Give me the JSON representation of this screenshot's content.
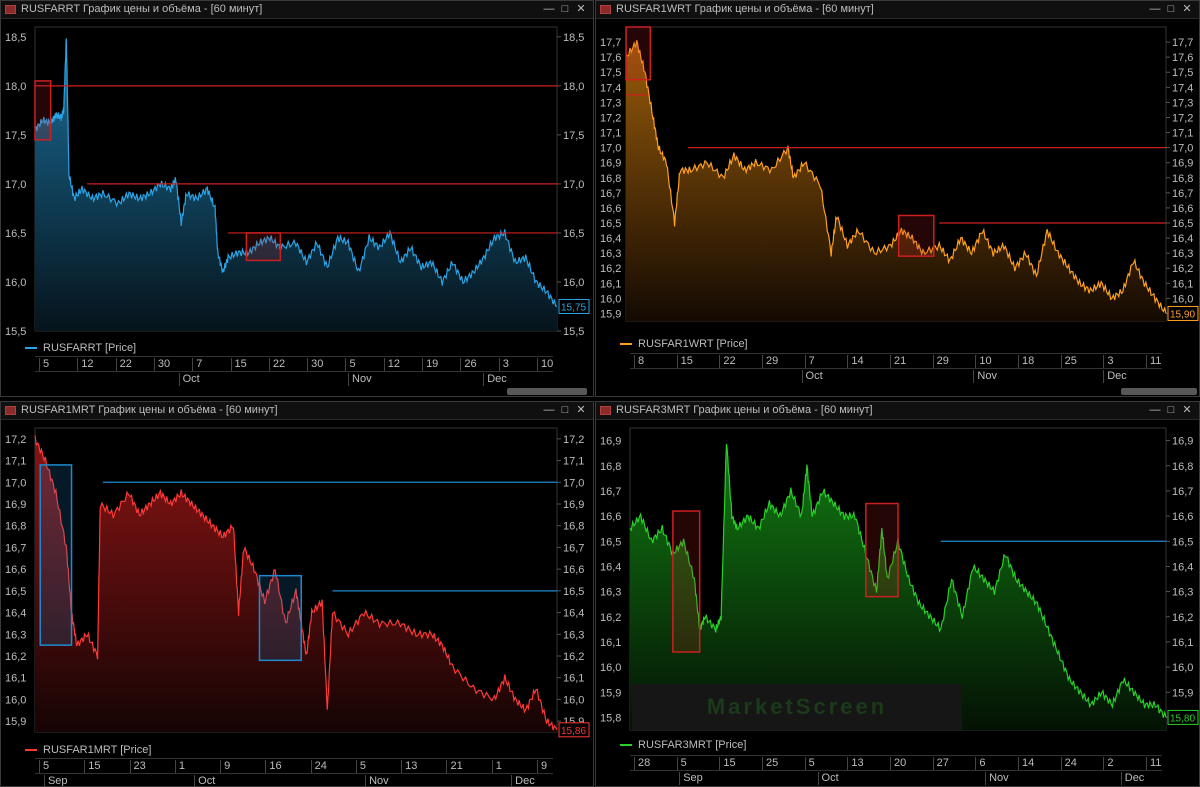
{
  "panels": [
    {
      "id": "p1",
      "title": "RUSFARRT График цены и объёма - [60 минут]",
      "legend": "RUSFARRT [Price]",
      "color": "#2aa4e6",
      "fill_top": "#1a6e9a",
      "fill_bot": "#06141c",
      "ylim": [
        15.5,
        18.6
      ],
      "ticks": [
        "15,5",
        "16,0",
        "16,5",
        "17,0",
        "17,5",
        "18,0",
        "18,5"
      ],
      "last": "15,75",
      "last_color": "#2aa4e6",
      "hlines": [
        {
          "y": 18.0,
          "color": "#cc2020",
          "from": 0.0
        },
        {
          "y": 17.0,
          "color": "#cc2020",
          "from": 0.1
        },
        {
          "y": 16.5,
          "color": "#cc2020",
          "from": 0.37
        }
      ],
      "boxes": [
        {
          "x0": 0.0,
          "x1": 0.03,
          "y0": 17.45,
          "y1": 18.05,
          "color": "#cc2020"
        },
        {
          "x0": 0.405,
          "x1": 0.47,
          "y0": 16.22,
          "y1": 16.5,
          "color": "#cc2020"
        }
      ],
      "xticks": [
        "5",
        "12",
        "22",
        "30",
        "7",
        "15",
        "22",
        "30",
        "5",
        "12",
        "19",
        "26",
        "3",
        "10"
      ],
      "months": [
        {
          "label": "Oct",
          "pos": 0.285
        },
        {
          "label": "Nov",
          "pos": 0.612
        },
        {
          "label": "Dec",
          "pos": 0.873
        }
      ],
      "series": [
        [
          0,
          17.55
        ],
        [
          0.015,
          17.65
        ],
        [
          0.03,
          17.62
        ],
        [
          0.04,
          17.7
        ],
        [
          0.05,
          17.68
        ],
        [
          0.055,
          17.75
        ],
        [
          0.06,
          18.5
        ],
        [
          0.065,
          17.1
        ],
        [
          0.075,
          16.85
        ],
        [
          0.09,
          16.95
        ],
        [
          0.11,
          16.85
        ],
        [
          0.13,
          16.9
        ],
        [
          0.16,
          16.8
        ],
        [
          0.18,
          16.9
        ],
        [
          0.2,
          16.85
        ],
        [
          0.22,
          16.9
        ],
        [
          0.24,
          17.0
        ],
        [
          0.26,
          16.95
        ],
        [
          0.27,
          17.05
        ],
        [
          0.28,
          16.6
        ],
        [
          0.29,
          16.9
        ],
        [
          0.31,
          16.85
        ],
        [
          0.33,
          16.95
        ],
        [
          0.345,
          16.75
        ],
        [
          0.35,
          16.3
        ],
        [
          0.36,
          16.1
        ],
        [
          0.37,
          16.25
        ],
        [
          0.39,
          16.3
        ],
        [
          0.41,
          16.3
        ],
        [
          0.43,
          16.4
        ],
        [
          0.45,
          16.45
        ],
        [
          0.47,
          16.35
        ],
        [
          0.5,
          16.4
        ],
        [
          0.52,
          16.2
        ],
        [
          0.54,
          16.4
        ],
        [
          0.56,
          16.15
        ],
        [
          0.58,
          16.45
        ],
        [
          0.6,
          16.4
        ],
        [
          0.62,
          16.1
        ],
        [
          0.64,
          16.45
        ],
        [
          0.66,
          16.35
        ],
        [
          0.68,
          16.5
        ],
        [
          0.7,
          16.2
        ],
        [
          0.72,
          16.35
        ],
        [
          0.74,
          16.15
        ],
        [
          0.76,
          16.2
        ],
        [
          0.78,
          16.0
        ],
        [
          0.8,
          16.2
        ],
        [
          0.82,
          16.0
        ],
        [
          0.84,
          16.1
        ],
        [
          0.86,
          16.25
        ],
        [
          0.88,
          16.45
        ],
        [
          0.9,
          16.5
        ],
        [
          0.92,
          16.2
        ],
        [
          0.94,
          16.25
        ],
        [
          0.96,
          16.0
        ],
        [
          0.98,
          15.9
        ],
        [
          1.0,
          15.75
        ]
      ]
    },
    {
      "id": "p2",
      "title": "RUSFAR1WRT График цены и объёма - [60 минут]",
      "legend": "RUSFAR1WRT [Price]",
      "color": "#ffa020",
      "fill_top": "#9a5c0a",
      "fill_bot": "#140a02",
      "ylim": [
        15.85,
        17.8
      ],
      "ticks": [
        "15,9",
        "16,0",
        "16,1",
        "16,2",
        "16,3",
        "16,4",
        "16,5",
        "16,6",
        "16,7",
        "16,8",
        "16,9",
        "17,0",
        "17,1",
        "17,2",
        "17,3",
        "17,4",
        "17,5",
        "17,6",
        "17,7"
      ],
      "last": "15,90",
      "last_color": "#ffa020",
      "hlines": [
        {
          "y": 17.35,
          "color": "#cc2020",
          "from": 0.0,
          "to": 0.04
        },
        {
          "y": 17.0,
          "color": "#cc2020",
          "from": 0.115
        },
        {
          "y": 16.5,
          "color": "#cc2020",
          "from": 0.58
        }
      ],
      "boxes": [
        {
          "x0": 0.0,
          "x1": 0.045,
          "y0": 17.45,
          "y1": 17.8,
          "color": "#cc2020"
        },
        {
          "x0": 0.505,
          "x1": 0.57,
          "y0": 16.28,
          "y1": 16.55,
          "color": "#cc2020"
        }
      ],
      "xticks": [
        "8",
        "15",
        "22",
        "29",
        "7",
        "14",
        "21",
        "29",
        "10",
        "18",
        "25",
        "3",
        "11"
      ],
      "months": [
        {
          "label": "Oct",
          "pos": 0.33
        },
        {
          "label": "Nov",
          "pos": 0.653
        },
        {
          "label": "Dec",
          "pos": 0.897
        }
      ],
      "series": [
        [
          0,
          17.6
        ],
        [
          0.02,
          17.7
        ],
        [
          0.035,
          17.5
        ],
        [
          0.05,
          17.2
        ],
        [
          0.06,
          17.0
        ],
        [
          0.075,
          16.9
        ],
        [
          0.09,
          16.5
        ],
        [
          0.1,
          16.85
        ],
        [
          0.12,
          16.85
        ],
        [
          0.15,
          16.9
        ],
        [
          0.18,
          16.8
        ],
        [
          0.2,
          16.95
        ],
        [
          0.22,
          16.85
        ],
        [
          0.24,
          16.9
        ],
        [
          0.27,
          16.85
        ],
        [
          0.3,
          17.0
        ],
        [
          0.31,
          16.8
        ],
        [
          0.33,
          16.9
        ],
        [
          0.36,
          16.75
        ],
        [
          0.38,
          16.3
        ],
        [
          0.39,
          16.55
        ],
        [
          0.41,
          16.35
        ],
        [
          0.43,
          16.45
        ],
        [
          0.46,
          16.3
        ],
        [
          0.49,
          16.35
        ],
        [
          0.51,
          16.45
        ],
        [
          0.53,
          16.4
        ],
        [
          0.55,
          16.3
        ],
        [
          0.58,
          16.35
        ],
        [
          0.6,
          16.25
        ],
        [
          0.62,
          16.4
        ],
        [
          0.64,
          16.3
        ],
        [
          0.66,
          16.45
        ],
        [
          0.68,
          16.3
        ],
        [
          0.7,
          16.35
        ],
        [
          0.72,
          16.2
        ],
        [
          0.74,
          16.3
        ],
        [
          0.76,
          16.15
        ],
        [
          0.78,
          16.45
        ],
        [
          0.8,
          16.3
        ],
        [
          0.82,
          16.2
        ],
        [
          0.84,
          16.1
        ],
        [
          0.86,
          16.05
        ],
        [
          0.88,
          16.1
        ],
        [
          0.9,
          16.0
        ],
        [
          0.92,
          16.05
        ],
        [
          0.94,
          16.25
        ],
        [
          0.96,
          16.1
        ],
        [
          0.98,
          16.0
        ],
        [
          1.0,
          15.9
        ]
      ]
    },
    {
      "id": "p3",
      "title": "RUSFAR1MRT График цены и объёма - [60 минут]",
      "legend": "RUSFAR1MRT [Price]",
      "color": "#ff3838",
      "fill_top": "#8a1414",
      "fill_bot": "#160404",
      "ylim": [
        15.85,
        17.25
      ],
      "ticks": [
        "15,9",
        "16,0",
        "16,1",
        "16,2",
        "16,3",
        "16,4",
        "16,5",
        "16,6",
        "16,7",
        "16,8",
        "16,9",
        "17,0",
        "17,1",
        "17,2"
      ],
      "last": "15,86",
      "last_color": "#ff3838",
      "hlines": [
        {
          "y": 17.0,
          "color": "#1d8ad0",
          "from": 0.13
        },
        {
          "y": 16.5,
          "color": "#1d8ad0",
          "from": 0.57
        }
      ],
      "boxes": [
        {
          "x0": 0.01,
          "x1": 0.07,
          "y0": 16.25,
          "y1": 17.08,
          "color": "#1d8ad0"
        },
        {
          "x0": 0.43,
          "x1": 0.51,
          "y0": 16.18,
          "y1": 16.57,
          "color": "#1d8ad0"
        }
      ],
      "xticks": [
        "5",
        "15",
        "23",
        "1",
        "9",
        "16",
        "24",
        "5",
        "13",
        "21",
        "1",
        "9"
      ],
      "months": [
        {
          "label": "Sep",
          "pos": 0.025
        },
        {
          "label": "Oct",
          "pos": 0.315
        },
        {
          "label": "Nov",
          "pos": 0.645
        },
        {
          "label": "Dec",
          "pos": 0.927
        }
      ],
      "series": [
        [
          0,
          17.2
        ],
        [
          0.02,
          17.1
        ],
        [
          0.04,
          16.95
        ],
        [
          0.06,
          16.7
        ],
        [
          0.07,
          16.4
        ],
        [
          0.08,
          16.25
        ],
        [
          0.1,
          16.3
        ],
        [
          0.12,
          16.2
        ],
        [
          0.125,
          16.9
        ],
        [
          0.15,
          16.85
        ],
        [
          0.18,
          16.95
        ],
        [
          0.2,
          16.85
        ],
        [
          0.22,
          16.9
        ],
        [
          0.24,
          16.95
        ],
        [
          0.26,
          16.9
        ],
        [
          0.28,
          16.95
        ],
        [
          0.3,
          16.9
        ],
        [
          0.32,
          16.85
        ],
        [
          0.34,
          16.8
        ],
        [
          0.36,
          16.75
        ],
        [
          0.38,
          16.8
        ],
        [
          0.39,
          16.4
        ],
        [
          0.4,
          16.7
        ],
        [
          0.42,
          16.6
        ],
        [
          0.44,
          16.45
        ],
        [
          0.46,
          16.6
        ],
        [
          0.48,
          16.35
        ],
        [
          0.5,
          16.5
        ],
        [
          0.51,
          16.35
        ],
        [
          0.52,
          16.2
        ],
        [
          0.53,
          16.4
        ],
        [
          0.55,
          16.45
        ],
        [
          0.56,
          15.95
        ],
        [
          0.57,
          16.4
        ],
        [
          0.6,
          16.3
        ],
        [
          0.63,
          16.4
        ],
        [
          0.66,
          16.35
        ],
        [
          0.7,
          16.35
        ],
        [
          0.73,
          16.3
        ],
        [
          0.76,
          16.3
        ],
        [
          0.78,
          16.25
        ],
        [
          0.8,
          16.15
        ],
        [
          0.84,
          16.05
        ],
        [
          0.88,
          16.0
        ],
        [
          0.9,
          16.1
        ],
        [
          0.92,
          16.0
        ],
        [
          0.94,
          15.95
        ],
        [
          0.96,
          16.05
        ],
        [
          0.98,
          15.9
        ],
        [
          1.0,
          15.86
        ]
      ]
    },
    {
      "id": "p4",
      "title": "RUSFAR3MRT График цены и объёма - [60 минут]",
      "legend": "RUSFAR3MRT [Price]",
      "color": "#28d028",
      "fill_top": "#127a12",
      "fill_bot": "#041204",
      "ylim": [
        15.75,
        16.95
      ],
      "ticks": [
        "15,8",
        "15,9",
        "16,0",
        "16,1",
        "16,2",
        "16,3",
        "16,4",
        "16,5",
        "16,6",
        "16,7",
        "16,8",
        "16,9"
      ],
      "last": "15,80",
      "last_color": "#28d028",
      "hlines": [
        {
          "y": 16.5,
          "color": "#1d8ad0",
          "from": 0.58
        }
      ],
      "boxes": [
        {
          "x0": 0.08,
          "x1": 0.13,
          "y0": 16.06,
          "y1": 16.62,
          "color": "#cc2020"
        },
        {
          "x0": 0.44,
          "x1": 0.5,
          "y0": 16.28,
          "y1": 16.65,
          "color": "#cc2020"
        }
      ],
      "xticks": [
        "28",
        "5",
        "15",
        "25",
        "5",
        "13",
        "20",
        "27",
        "6",
        "14",
        "24",
        "2",
        "11"
      ],
      "months": [
        {
          "label": "Sep",
          "pos": 0.1
        },
        {
          "label": "Oct",
          "pos": 0.36
        },
        {
          "label": "Nov",
          "pos": 0.675
        },
        {
          "label": "Dec",
          "pos": 0.93
        }
      ],
      "series": [
        [
          0,
          16.55
        ],
        [
          0.02,
          16.6
        ],
        [
          0.04,
          16.5
        ],
        [
          0.06,
          16.55
        ],
        [
          0.08,
          16.45
        ],
        [
          0.1,
          16.5
        ],
        [
          0.12,
          16.35
        ],
        [
          0.13,
          16.15
        ],
        [
          0.14,
          16.2
        ],
        [
          0.16,
          16.15
        ],
        [
          0.17,
          16.2
        ],
        [
          0.18,
          16.9
        ],
        [
          0.19,
          16.6
        ],
        [
          0.2,
          16.55
        ],
        [
          0.22,
          16.6
        ],
        [
          0.24,
          16.55
        ],
        [
          0.26,
          16.65
        ],
        [
          0.28,
          16.6
        ],
        [
          0.3,
          16.7
        ],
        [
          0.32,
          16.6
        ],
        [
          0.33,
          16.8
        ],
        [
          0.34,
          16.6
        ],
        [
          0.36,
          16.7
        ],
        [
          0.38,
          16.65
        ],
        [
          0.4,
          16.6
        ],
        [
          0.42,
          16.6
        ],
        [
          0.44,
          16.45
        ],
        [
          0.46,
          16.3
        ],
        [
          0.47,
          16.55
        ],
        [
          0.48,
          16.35
        ],
        [
          0.5,
          16.5
        ],
        [
          0.52,
          16.35
        ],
        [
          0.54,
          16.25
        ],
        [
          0.56,
          16.2
        ],
        [
          0.58,
          16.15
        ],
        [
          0.6,
          16.35
        ],
        [
          0.62,
          16.2
        ],
        [
          0.64,
          16.4
        ],
        [
          0.66,
          16.35
        ],
        [
          0.68,
          16.3
        ],
        [
          0.7,
          16.45
        ],
        [
          0.72,
          16.35
        ],
        [
          0.74,
          16.3
        ],
        [
          0.76,
          16.25
        ],
        [
          0.78,
          16.15
        ],
        [
          0.8,
          16.05
        ],
        [
          0.82,
          15.95
        ],
        [
          0.84,
          15.9
        ],
        [
          0.86,
          15.85
        ],
        [
          0.88,
          15.9
        ],
        [
          0.9,
          15.85
        ],
        [
          0.92,
          15.95
        ],
        [
          0.94,
          15.9
        ],
        [
          0.96,
          15.85
        ],
        [
          0.98,
          15.85
        ],
        [
          1.0,
          15.8
        ]
      ]
    }
  ],
  "watermark": "MarketScreen"
}
